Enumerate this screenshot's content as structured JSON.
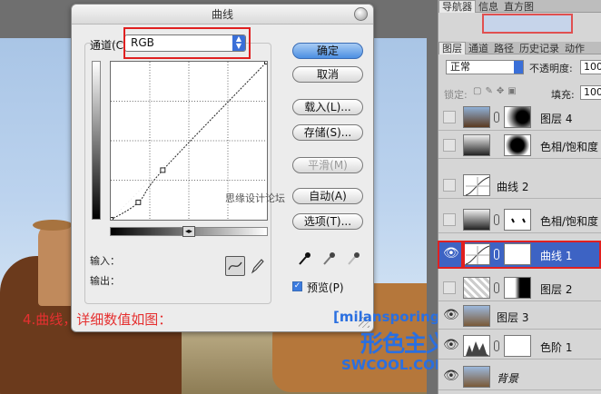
{
  "dialog": {
    "title": "曲线",
    "channel_label": "通道(C):",
    "channel_value": "RGB",
    "input_label": "输入：",
    "output_label": "输出：",
    "buttons": {
      "ok": "确定",
      "cancel": "取消",
      "load": "载入(L)...",
      "save": "存储(S)...",
      "smooth": "平滑(M)",
      "auto": "自动(A)",
      "options": "选项(T)..."
    },
    "preview_label": "预览(P)",
    "preview_checked": true
  },
  "overlay": {
    "watermark": "思缘设计论坛",
    "caption": "4.曲线，详细数值如图：",
    "brand_line1": "[milansporing教程]",
    "brand_line2": "形色主义",
    "brand_line3": "SWCOOL.COM"
  },
  "panel": {
    "top_tabs": [
      "导航器",
      "信息",
      "直方图"
    ],
    "layer_tabs": [
      "图层",
      "通道",
      "路径",
      "历史记录",
      "动作"
    ],
    "blend_mode": "正常",
    "opacity_label": "不透明度:",
    "opacity_value": "100",
    "lock_label": "锁定:",
    "fill_label": "填充:",
    "fill_value": "100",
    "layers": [
      {
        "name": "图层 4",
        "visible": false,
        "selected": false,
        "has_mask": true
      },
      {
        "name": "色相/饱和度",
        "visible": false,
        "selected": false,
        "has_mask": false
      },
      {
        "name": "曲线 2",
        "visible": false,
        "selected": false,
        "has_mask": false
      },
      {
        "name": "色相/饱和度",
        "visible": false,
        "selected": false,
        "has_mask": true
      },
      {
        "name": "曲线 1",
        "visible": true,
        "selected": true,
        "has_mask": true
      },
      {
        "name": "图层 2",
        "visible": false,
        "selected": false,
        "has_mask": true
      },
      {
        "name": "图层 3",
        "visible": true,
        "selected": false,
        "has_mask": false
      },
      {
        "name": "色阶 1",
        "visible": true,
        "selected": false,
        "has_mask": true
      },
      {
        "name": "背景",
        "visible": true,
        "selected": false,
        "has_mask": false
      }
    ]
  },
  "curve": {
    "points": [
      [
        0,
        0
      ],
      [
        45,
        28
      ],
      [
        85,
        80
      ],
      [
        255,
        255
      ]
    ]
  },
  "colors": {
    "highlight_red": "#e02020",
    "selection_blue": "#3d63c4",
    "brand_blue": "#2a6fe0",
    "caption_red": "#e53030"
  }
}
